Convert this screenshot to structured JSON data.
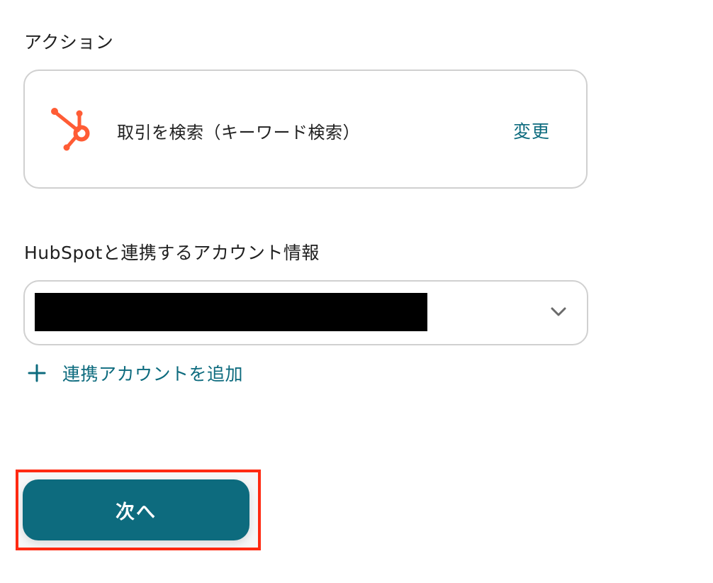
{
  "action_section": {
    "label": "アクション",
    "app_icon": "hubspot-icon",
    "action_name": "取引を検索（キーワード検索）",
    "change_label": "変更"
  },
  "account_section": {
    "label": "HubSpotと連携するアカウント情報",
    "selected_value": "",
    "dropdown_icon": "chevron-down-icon",
    "add_label": "連携アカウントを追加",
    "add_icon": "plus-icon"
  },
  "next_button": {
    "label": "次へ"
  },
  "colors": {
    "accent": "#0d6b7e",
    "hubspot_orange": "#ff5c35",
    "highlight_border": "#ff2a12",
    "card_border": "#d0d0d0"
  }
}
